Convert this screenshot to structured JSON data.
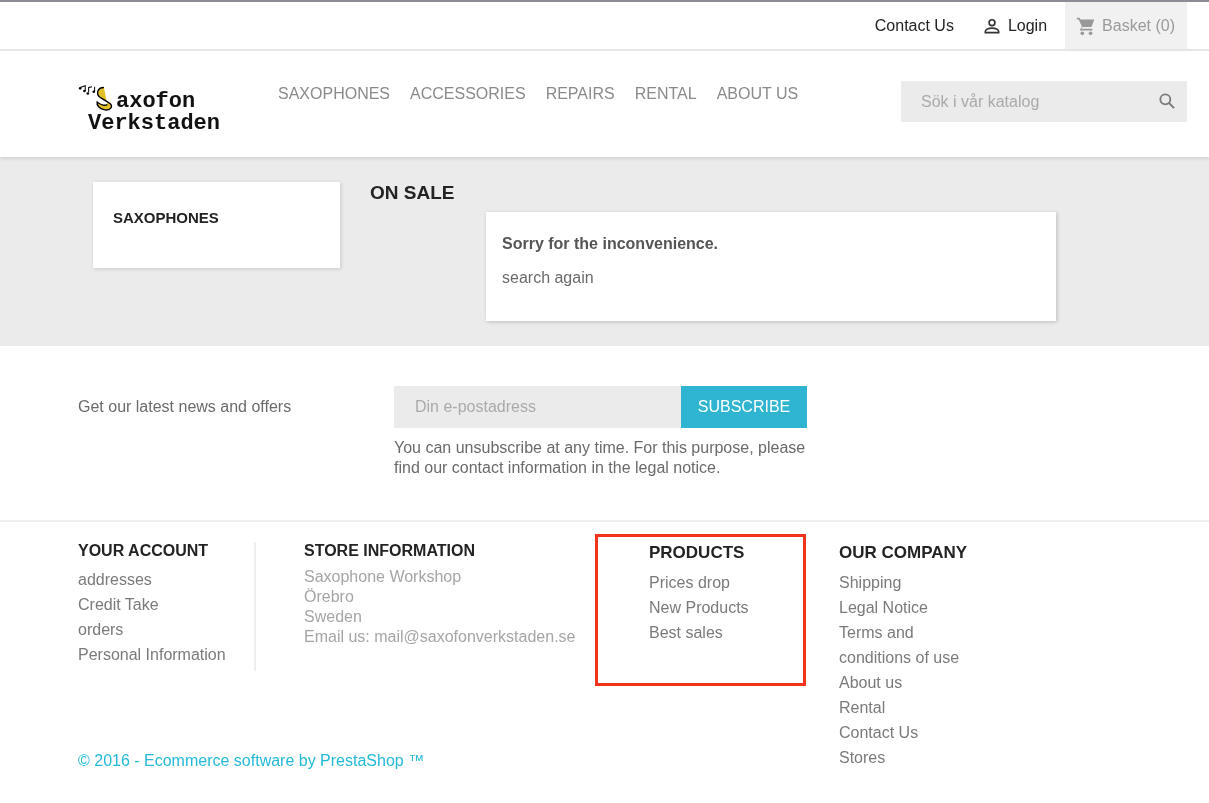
{
  "top_bar": {
    "contact": "Contact Us",
    "login": "Login",
    "basket": "Basket (0)"
  },
  "logo": {
    "lines": [
      "axofon",
      "Verkstaden"
    ]
  },
  "nav": [
    "SAXOPHONES",
    "ACCESSORIES",
    "REPAIRS",
    "RENTAL",
    "ABOUT US"
  ],
  "search": {
    "placeholder": "Sök i vår katalog"
  },
  "sidebar": {
    "title": "SAXOPHONES"
  },
  "page_title": "ON SALE",
  "notice": {
    "heading": "Sorry for the inconvenience.",
    "text": "search again"
  },
  "newsletter": {
    "label": "Get our latest news and offers",
    "placeholder": "Din e-postadress",
    "button": "SUBSCRIBE",
    "conditions": "You can unsubscribe at any time. For this purpose, please find our contact information in the legal notice."
  },
  "footer_columns": [
    {
      "kind": "links",
      "title": "YOUR ACCOUNT",
      "highlighted": false,
      "items": [
        "addresses",
        "Credit Take",
        "orders",
        "Personal Information"
      ]
    },
    {
      "kind": "info",
      "title": "STORE INFORMATION",
      "highlighted": false,
      "items": [
        "Saxophone Workshop",
        "Örebro",
        "Sweden",
        "Email us: mail@saxofonverkstaden.se"
      ]
    },
    {
      "kind": "links",
      "title": "PRODUCTS",
      "highlighted": true,
      "items": [
        "Prices drop",
        "New Products",
        "Best sales"
      ]
    },
    {
      "kind": "links",
      "title": "OUR COMPANY",
      "highlighted": false,
      "items": [
        "Shipping",
        "Legal Notice",
        "Terms and conditions of use",
        "About us",
        "Rental",
        "Contact Us",
        "Stores"
      ]
    }
  ],
  "copyright": "© 2016 - Ecommerce software by PrestaShop ™"
}
